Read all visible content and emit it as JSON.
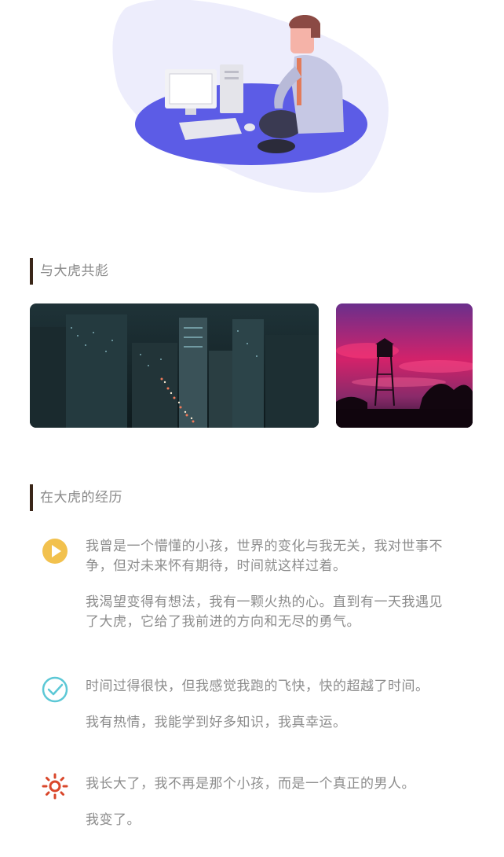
{
  "sections": {
    "gallery_title": "与大虎共彪",
    "experience_title": "在大虎的经历"
  },
  "gallery": {
    "images": [
      {
        "name": "city-night-photo"
      },
      {
        "name": "pink-sunset-tower-photo"
      }
    ]
  },
  "timeline": [
    {
      "icon": "play-circle-icon",
      "color": "#f2c14e",
      "paragraphs": [
        "我曾是一个懵懂的小孩，世界的变化与我无关，我对世事不争，但对未来怀有期待，时间就这样过着。",
        "我渴望变得有想法，我有一颗火热的心。直到有一天我遇见了大虎，它给了我前进的方向和无尽的勇气。"
      ]
    },
    {
      "icon": "check-circle-icon",
      "color": "#5cc8d6",
      "paragraphs": [
        "时间过得很快，但我感觉我跑的飞快，快的超越了时间。",
        "我有热情，我能学到好多知识，我真幸运。"
      ]
    },
    {
      "icon": "sun-icon",
      "color": "#d9472b",
      "paragraphs": [
        "我长大了，我不再是那个小孩，而是一个真正的男人。",
        "我变了。"
      ]
    }
  ]
}
